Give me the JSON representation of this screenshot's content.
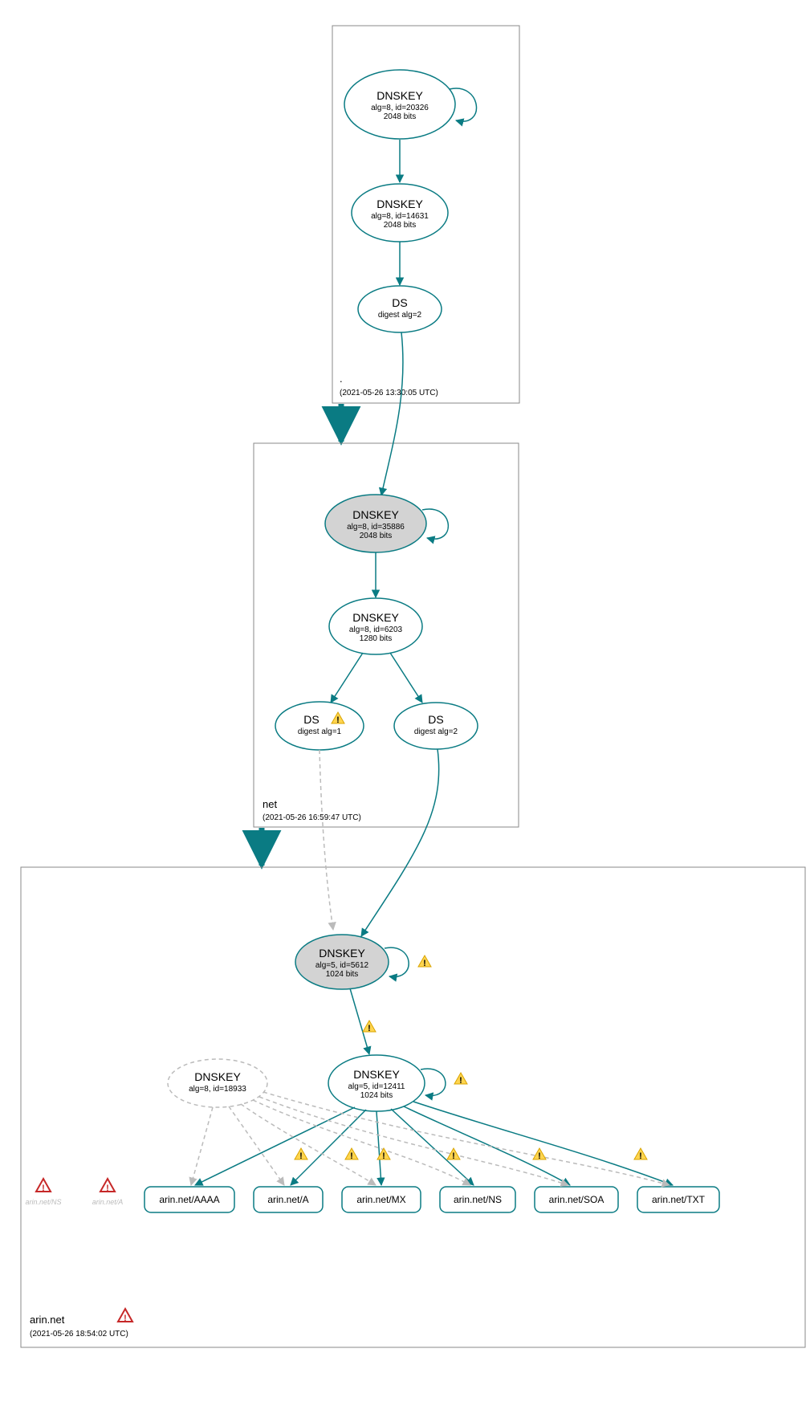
{
  "zones": {
    "root": {
      "label": ".",
      "time": "(2021-05-26 13:30:05 UTC)"
    },
    "net": {
      "label": "net",
      "time": "(2021-05-26 16:59:47 UTC)"
    },
    "arin": {
      "label": "arin.net",
      "time": "(2021-05-26 18:54:02 UTC)"
    }
  },
  "nodes": {
    "root_ksk": {
      "title": "DNSKEY",
      "line1": "alg=8, id=20326",
      "line2": "2048 bits"
    },
    "root_zsk": {
      "title": "DNSKEY",
      "line1": "alg=8, id=14631",
      "line2": "2048 bits"
    },
    "root_ds": {
      "title": "DS",
      "line1": "digest alg=2"
    },
    "net_ksk": {
      "title": "DNSKEY",
      "line1": "alg=8, id=35886",
      "line2": "2048 bits"
    },
    "net_zsk": {
      "title": "DNSKEY",
      "line1": "alg=8, id=6203",
      "line2": "1280 bits"
    },
    "net_ds1": {
      "title": "DS",
      "line1": "digest alg=1"
    },
    "net_ds2": {
      "title": "DS",
      "line1": "digest alg=2"
    },
    "arin_ksk": {
      "title": "DNSKEY",
      "line1": "alg=5, id=5612",
      "line2": "1024 bits"
    },
    "arin_zsk": {
      "title": "DNSKEY",
      "line1": "alg=5, id=12411",
      "line2": "1024 bits"
    },
    "arin_ghost": {
      "title": "DNSKEY",
      "line1": "alg=8, id=18933"
    },
    "rr_aaaa": {
      "label": "arin.net/AAAA"
    },
    "rr_a": {
      "label": "arin.net/A"
    },
    "rr_mx": {
      "label": "arin.net/MX"
    },
    "rr_ns": {
      "label": "arin.net/NS"
    },
    "rr_soa": {
      "label": "arin.net/SOA"
    },
    "rr_txt": {
      "label": "arin.net/TXT"
    },
    "ghost_ns": {
      "label": "arin.net/NS"
    },
    "ghost_a": {
      "label": "arin.net/A"
    }
  }
}
